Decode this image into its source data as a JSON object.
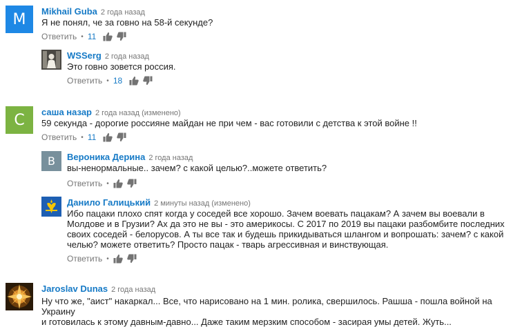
{
  "comments": [
    {
      "author": "Mikhail Guba",
      "time": "2 года назад",
      "text": "Я не понял, че за говно на 58-й секунде?",
      "reply": "Ответить",
      "likes": "11",
      "avatar_letter": "M",
      "avatar_color": "#1e88e5"
    },
    {
      "author": "WSSerg",
      "time": "2 года назад",
      "text": "Это говно зовется россия.",
      "reply": "Ответить",
      "likes": "18"
    },
    {
      "author": "саша назар",
      "time": "2 года назад (изменено)",
      "text": "59 секунда - дорогие россияне майдан не при чем - вас готовили с детства к этой войне !!",
      "reply": "Ответить",
      "likes": "11",
      "avatar_letter": "C",
      "avatar_color": "#7cb342"
    },
    {
      "author": "Вероника Дерина",
      "time": "2 года назад",
      "text": "вы-ненормальные.. зачем? с какой целью?..можете ответить?",
      "reply": "Ответить",
      "avatar_letter": "B",
      "avatar_color": "#78909c"
    },
    {
      "author": "Данило Галицький",
      "time": "2 минуты назад (изменено)",
      "text_lines": [
        "Ибо пацаки плохо спят когда у соседей все хорошо. Зачем воевать пацакам? А зачем вы воевали в",
        "Молдове и в Грузии? Ах да это не вы - это америкосы. С 2017 по 2019 вы пацаки разбомбите последних",
        "своих соседей - белорусов. А ты все так и будешь прикидываться шлангом и вопрошать: зачем? с какой",
        "челью? можете ответить? Просто пацак - тварь агрессивная и винствующая."
      ],
      "reply": "Ответить"
    },
    {
      "author": "Jaroslav Dunas",
      "time": "2 года назад",
      "text_lines": [
        "Ну что же, \"аист\" накаркал... Все, что нарисовано на 1 мин. ролика, свершилось. Рашша - пошла войной на Украину",
        "и готовилась к этому давным-давно... Даже таким мерзким способом - засирая умы детей. Жуть..."
      ]
    }
  ]
}
